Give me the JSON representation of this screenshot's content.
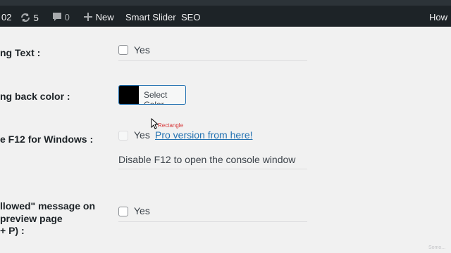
{
  "adminbar": {
    "left_fragment": "02",
    "updates_count": "5",
    "comments_count": "0",
    "new_label": "New",
    "smart_slider_label": "Smart Slider",
    "seo_label": "SEO",
    "howdy_fragment": "How"
  },
  "rows": [
    {
      "label": "ng Text :",
      "checkbox_label": "Yes"
    },
    {
      "label": "ng back color :",
      "button_label": "Select Color",
      "swatch_color": "#000000"
    },
    {
      "label": "e F12 for Windows :",
      "checkbox_label": "Yes",
      "pro_link": "Pro version from here!",
      "description": "Disable F12 to open the console window"
    },
    {
      "label_lines": [
        "llowed\" message on",
        "preview page",
        "+ P) :"
      ],
      "checkbox_label": "Yes"
    }
  ],
  "overlay": {
    "tooltip": "Rectangle",
    "watermark": "Somo..."
  },
  "colors": {
    "accent": "#2271b1",
    "adminbar_bg": "#1d2327",
    "page_bg": "#f1f1f1"
  }
}
